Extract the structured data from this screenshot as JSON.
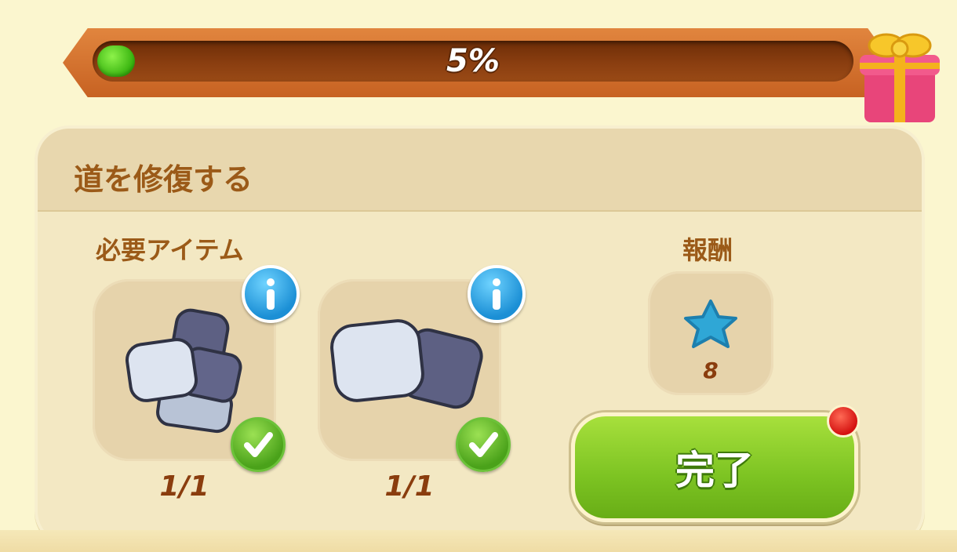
{
  "progress": {
    "value_percent": 5,
    "label": "5%"
  },
  "quest": {
    "title": "道を修復する"
  },
  "required": {
    "label": "必要アイテム",
    "items": [
      {
        "name": "stones-pile",
        "count": "1/1",
        "complete": true
      },
      {
        "name": "stones-pair",
        "count": "1/1",
        "complete": true
      }
    ]
  },
  "reward": {
    "label": "報酬",
    "icon": "blue-star-icon",
    "count": "8"
  },
  "complete_button": {
    "label": "完了",
    "notification": true
  },
  "colors": {
    "accent_green": "#7cc322",
    "title_brown": "#9b5a18",
    "progress_frame": "#d8722f",
    "info_blue": "#1b8fd5"
  }
}
